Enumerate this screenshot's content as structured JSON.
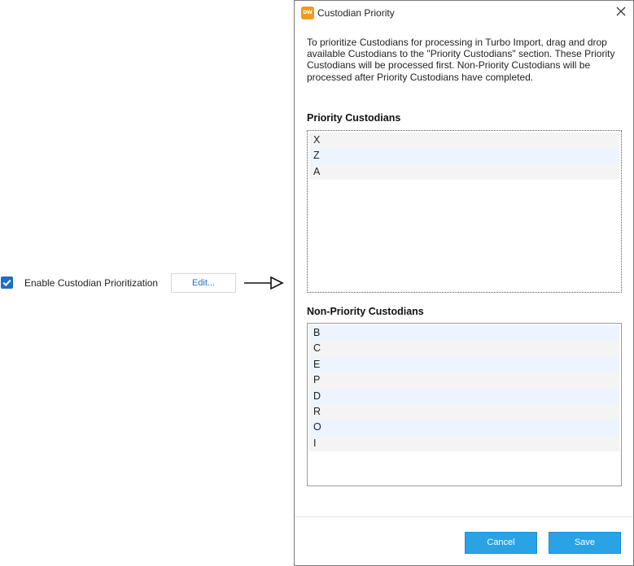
{
  "setting": {
    "checked": true,
    "label": "Enable Custodian Prioritization",
    "edit_label": "Edit..."
  },
  "dialog": {
    "app_icon_text": "DW",
    "title": "Custodian Priority",
    "description": "To prioritize Custodians for processing in Turbo Import, drag and drop available Custodians to the \"Priority Custodians\" section. These Priority Custodians will be processed first. Non-Priority Custodians will be processed after Priority Custodians have completed.",
    "priority_title": "Priority Custodians",
    "priority_items": [
      "X",
      "Z",
      "A"
    ],
    "nonpriority_title": "Non-Priority Custodians",
    "nonpriority_items": [
      "B",
      "C",
      "E",
      "P",
      "D",
      "R",
      "O",
      "I"
    ],
    "cancel_label": "Cancel",
    "save_label": "Save"
  },
  "colors": {
    "accent": "#1f6fc5",
    "button": "#29a3e6",
    "app_icon": "#f29a1f"
  }
}
